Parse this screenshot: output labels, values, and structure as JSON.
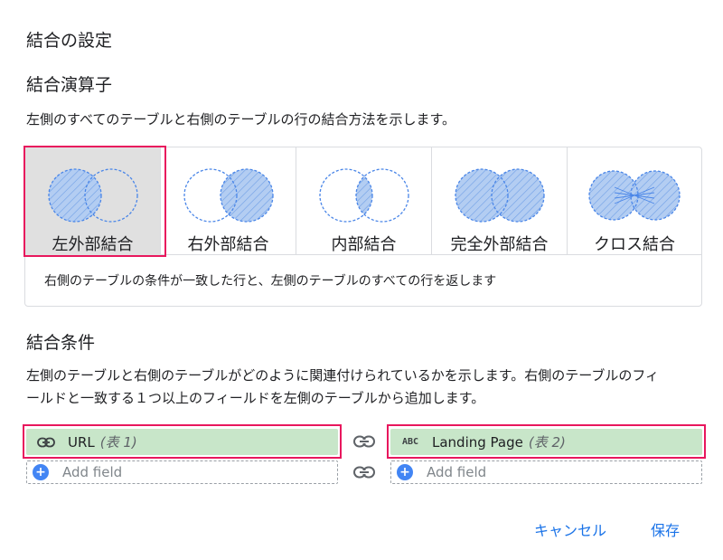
{
  "dialog": {
    "title": "結合の設定"
  },
  "operator": {
    "title": "結合演算子",
    "description": "左側のすべてのテーブルと右側のテーブルの行の結合方法を示します。",
    "options": [
      {
        "label": "左外部結合",
        "selected": true
      },
      {
        "label": "右外部結合",
        "selected": false
      },
      {
        "label": "内部結合",
        "selected": false
      },
      {
        "label": "完全外部結合",
        "selected": false
      },
      {
        "label": "クロス結合",
        "selected": false
      }
    ],
    "explanation": "右側のテーブルの条件が一致した行と、左側のテーブルのすべての行を返します"
  },
  "conditions": {
    "title": "結合条件",
    "description_line1": "左側のテーブルと右側のテーブルがどのように関連付けられているかを示します。右側のテーブルのフィ",
    "description_line2": "ールドと一致する１つ以上のフィールドを左側のテーブルから追加します。",
    "left_field": {
      "icon": "link-icon",
      "name": "URL",
      "table": "(表 1)"
    },
    "right_field": {
      "icon": "abc-text-icon",
      "icon_text": "ABC",
      "name": "Landing Page",
      "table": "(表 2)"
    },
    "add_field_label": "Add field"
  },
  "footer": {
    "cancel_label": "キャンセル",
    "save_label": "保存"
  },
  "colors": {
    "accent": "#1a73e8",
    "highlight": "#e8175d",
    "field_bg": "#c8e6c9",
    "venn_fill": "#a8c7f0",
    "venn_stroke": "#4a86e8"
  }
}
